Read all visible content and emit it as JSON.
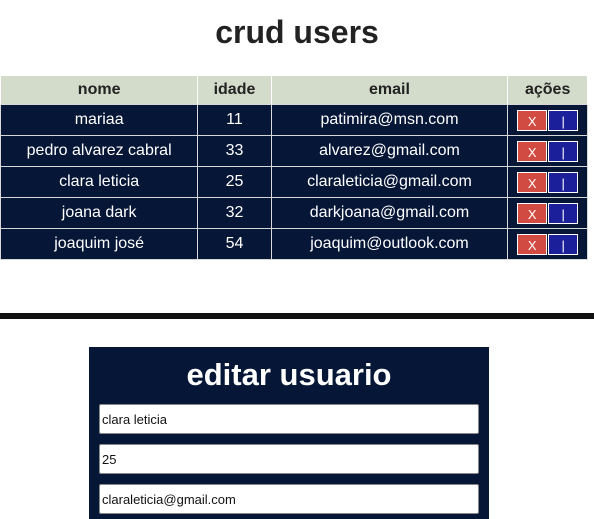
{
  "page": {
    "title": "crud users"
  },
  "table": {
    "headers": {
      "nome": "nome",
      "idade": "idade",
      "email": "email",
      "acoes": "ações"
    },
    "rows": [
      {
        "nome": "mariaa",
        "idade": "11",
        "email": "patimira@msn.com"
      },
      {
        "nome": "pedro alvarez cabral",
        "idade": "33",
        "email": "alvarez@gmail.com"
      },
      {
        "nome": "clara leticia",
        "idade": "25",
        "email": "claraleticia@gmail.com"
      },
      {
        "nome": "joana dark",
        "idade": "32",
        "email": "darkjoana@gmail.com"
      },
      {
        "nome": "joaquim josé",
        "idade": "54",
        "email": "joaquim@outlook.com"
      }
    ],
    "delete_label": "X",
    "edit_label": "|"
  },
  "edit_form": {
    "title": "editar usuario",
    "nome_value": "clara leticia",
    "idade_value": "25",
    "email_value": "claraleticia@gmail.com"
  },
  "colors": {
    "header_bg": "#d3dccb",
    "row_bg": "#061636",
    "delete_button": "#d24b42",
    "edit_button": "#1b1f9a"
  }
}
